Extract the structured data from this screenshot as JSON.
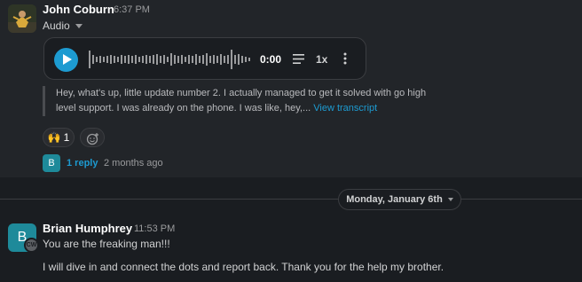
{
  "message1": {
    "author": "John Coburn",
    "time": "6:37 PM",
    "attachment_label": "Audio",
    "player": {
      "duration": "0:00",
      "speed": "1x",
      "play_icon": "play-icon",
      "transcript_toggle_icon": "lines-icon",
      "more_icon": "kebab-icon"
    },
    "transcript_text": "Hey, what's up, little update number 2. I actually managed to get it solved with go high level support. I was already on the phone. I was like, hey,...",
    "view_transcript_label": "View transcript",
    "reaction": {
      "emoji": "🙌",
      "count": "1"
    },
    "thread": {
      "avatar_letter": "B",
      "reply_label": "1 reply",
      "last_reply": "2 months ago"
    }
  },
  "date_divider": {
    "label": "Monday, January 6th"
  },
  "message2": {
    "author": "Brian Humphrey",
    "time": "11:53 PM",
    "avatar_letter": "B",
    "badge": "CW",
    "lines": [
      "You are the freaking man!!!",
      "I will dive in and connect the dots and report back. Thank you for the help my brother."
    ]
  },
  "colors": {
    "background": "#1a1d21",
    "hover_background": "#222529",
    "link": "#1d9bd1",
    "avatar_teal": "#1e8a9a"
  }
}
